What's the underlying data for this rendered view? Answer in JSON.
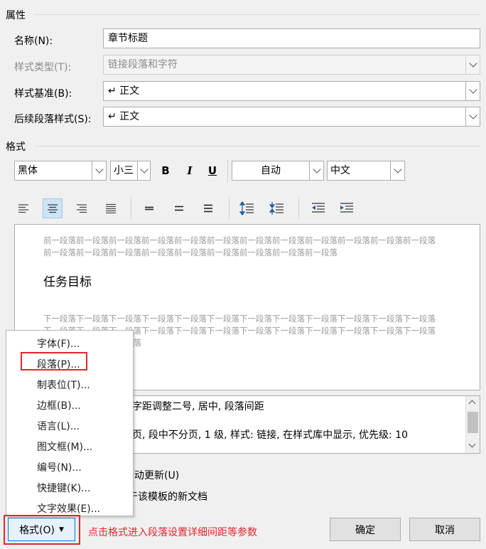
{
  "properties": {
    "section_title": "属性",
    "name_label": "名称(N):",
    "name_value": "章节标题",
    "style_type_label": "样式类型(T):",
    "style_type_value": "链接段落和字符",
    "style_based_label": "样式基准(B):",
    "style_based_value": "↵ 正文",
    "next_style_label": "后续段落样式(S):",
    "next_style_value": "↵ 正文"
  },
  "format": {
    "section_title": "格式",
    "font_name": "黑体",
    "font_size": "小三",
    "bold": "B",
    "italic": "I",
    "underline": "U",
    "color": "自动",
    "language": "中文"
  },
  "preview": {
    "prev_paragraph": "前一段落前一段落前一段落前一段落前一段落前一段落前一段落前一段落前一段落前一段落前一段落前一段落前一段落前一段落前一段落前一段落前一段落前一段落前一段落前一段落前一段落",
    "sample_text": "任务目标",
    "next_paragraph": "下一段落下一段落下一段落下一段落下一段落下一段落下一段落下一段落下一段落下一段落下一段落下一段落下一段落下一段落下一段落下一段落下一段落下一段落下一段落下一段落下一段落下一段落下一段落下一段落下一段落下一段落下一段落"
  },
  "description": {
    "line1": "字距调整二号, 居中, 段落间距",
    "line2": "页, 段中不分页, 1 级, 样式: 链接, 在样式库中显示, 优先级: 10"
  },
  "options": {
    "auto_update": "动更新(U)",
    "new_docs": "于该模板的新文档"
  },
  "menu": {
    "items": [
      "字体(F)...",
      "段落(P)...",
      "制表位(T)...",
      "边框(B)...",
      "语言(L)...",
      "图文框(M)...",
      "编号(N)...",
      "快捷键(K)...",
      "文字效果(E)..."
    ]
  },
  "buttons": {
    "format": "格式(O)",
    "ok": "确定",
    "cancel": "取消"
  },
  "annotation": "点击格式进入段落设置详细间距等参数",
  "colors": {
    "highlight_red": "#e4262c",
    "selected_bg": "#cde4f7"
  }
}
